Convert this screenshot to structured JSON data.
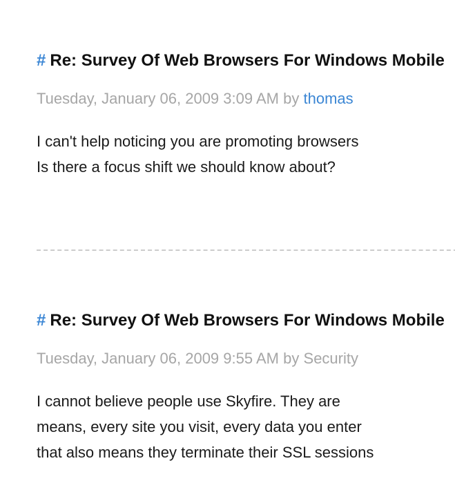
{
  "comments": [
    {
      "hash": "#",
      "title": "Re: Survey Of Web Browsers For Windows Mobile",
      "timestamp": "Tuesday, January 06, 2009 3:09 AM",
      "by": "by",
      "author": "thomas",
      "body_lines": [
        "I can't help noticing you are promoting browsers",
        "Is there a focus shift we should know about?"
      ]
    },
    {
      "hash": "#",
      "title": "Re: Survey Of Web Browsers For Windows Mobile",
      "timestamp": "Tuesday, January 06, 2009 9:55 AM",
      "by": "by",
      "author": "Security",
      "body_lines": [
        "I cannot believe people use Skyfire.  They are",
        "means, every site you visit, every data you enter",
        "that also means they terminate their SSL sessions"
      ]
    }
  ],
  "colors": {
    "link": "#3b86d4",
    "meta": "#a6a6a6",
    "separator": "#cccccc"
  }
}
